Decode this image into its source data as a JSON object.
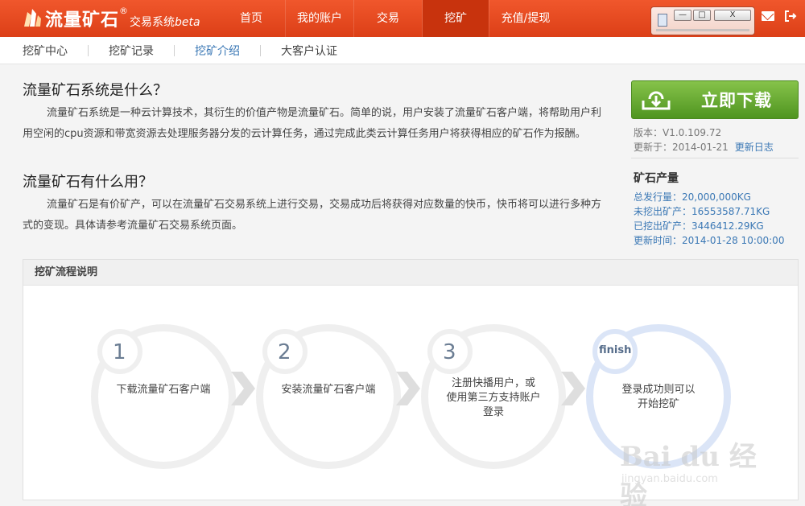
{
  "header": {
    "logo_main": "流量矿石",
    "logo_reg": "®",
    "logo_sub": "交易系统",
    "logo_beta": "beta",
    "nav": [
      {
        "label": "首页"
      },
      {
        "label": "我的账户"
      },
      {
        "label": "交易"
      },
      {
        "label": "挖矿",
        "active": true
      },
      {
        "label": "充值/提现"
      }
    ],
    "window_controls": {
      "min": "—",
      "max": "□",
      "close": "X"
    },
    "icons": [
      "logo-crystal-icon",
      "document-icon",
      "mail-icon",
      "logout-icon"
    ]
  },
  "subnav": [
    {
      "label": "挖矿中心"
    },
    {
      "label": "挖矿记录"
    },
    {
      "label": "挖矿介绍",
      "active": true
    },
    {
      "label": "大客户认证"
    }
  ],
  "intro": {
    "q1_title": "流量矿石系统是什么？",
    "q1_body": "流量矿石系统是一种云计算技术，其衍生的价值产物是流量矿石。简单的说，用户安装了流量矿石客户端，将帮助用户利用空闲的cpu资源和带宽资源去处理服务器分发的云计算任务，通过完成此类云计算任务用户将获得相应的矿石作为报酬。",
    "q2_title": "流量矿石有什么用？",
    "q2_body": "流量矿石是有价矿产，可以在流量矿石交易系统上进行交易，交易成功后将获得对应数量的快币，快币将可以进行多种方式的变现。具体请参考流量矿石交易系统页面。"
  },
  "download": {
    "button_label": "立即下载",
    "version": "版本：V1.0.109.72",
    "updated": "更新于：2014-01-21",
    "changelog_link": "更新日志"
  },
  "ore": {
    "title": "矿石产量",
    "total": "总发行量：20,000,000KG",
    "unmined": "未挖出矿产：16553587.71KG",
    "mined": "已挖出矿产：3446412.29KG",
    "updated": "更新时间：2014-01-28 10:00:00"
  },
  "flow": {
    "title": "挖矿流程说明",
    "steps": [
      {
        "num": "1",
        "lines": [
          "下载流量矿石客户端"
        ]
      },
      {
        "num": "2",
        "lines": [
          "安装流量矿石客户端"
        ]
      },
      {
        "num": "3",
        "lines": [
          "注册快播用户，或",
          "使用第三方支持账户",
          "登录"
        ]
      },
      {
        "num": "finish",
        "lines": [
          "登录成功则可以",
          "开始挖矿"
        ]
      }
    ]
  },
  "watermark": {
    "main": "Bai du 经验",
    "sub": "jingyan.baidu.com"
  },
  "colors": {
    "header": "#dc3f17",
    "nav_active": "#c8330d",
    "link": "#3b78b5",
    "download": "#5aa02a"
  }
}
